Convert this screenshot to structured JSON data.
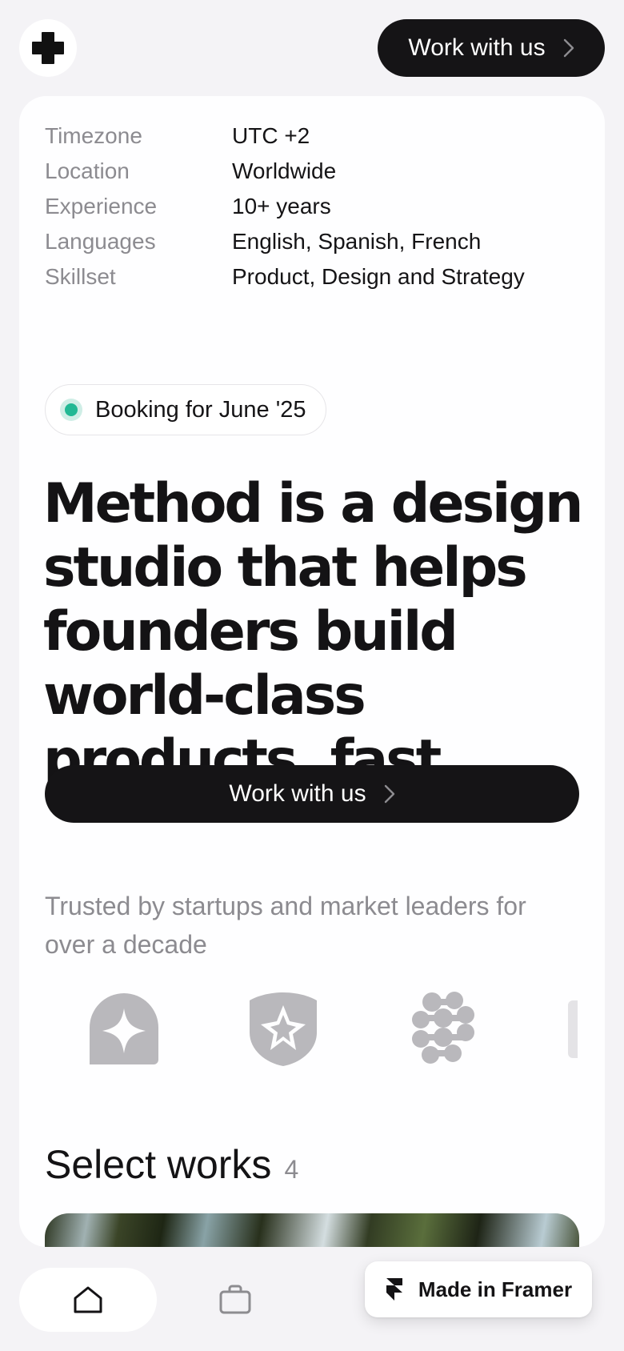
{
  "header": {
    "logo_name": "plus-logo-icon",
    "cta_label": "Work with us"
  },
  "info": [
    {
      "key": "Timezone",
      "value": "UTC +2"
    },
    {
      "key": "Location",
      "value": "Worldwide"
    },
    {
      "key": "Experience",
      "value": "10+ years"
    },
    {
      "key": "Languages",
      "value": "English, Spanish, French"
    },
    {
      "key": "Skillset",
      "value": "Product, Design and Strategy"
    }
  ],
  "badge": {
    "label": "Booking for June '25",
    "status_color": "#22b894"
  },
  "hero": {
    "headline": "Method is a design studio that helps founders build world-class products, fast.",
    "cta_label": "Work with us"
  },
  "trusted": {
    "text": "Trusted by startups and market leaders for over a decade"
  },
  "works": {
    "title": "Select works",
    "count": "4"
  },
  "bottom_nav": {
    "home_icon": "home-icon",
    "work_icon": "briefcase-icon"
  },
  "framer_badge": {
    "label": "Made in Framer"
  },
  "colors": {
    "page_bg": "#f4f3f6",
    "card_bg": "#fefeff",
    "dark": "#151416",
    "muted": "#8c8b90",
    "logo_gray": "#b9b8bc"
  }
}
